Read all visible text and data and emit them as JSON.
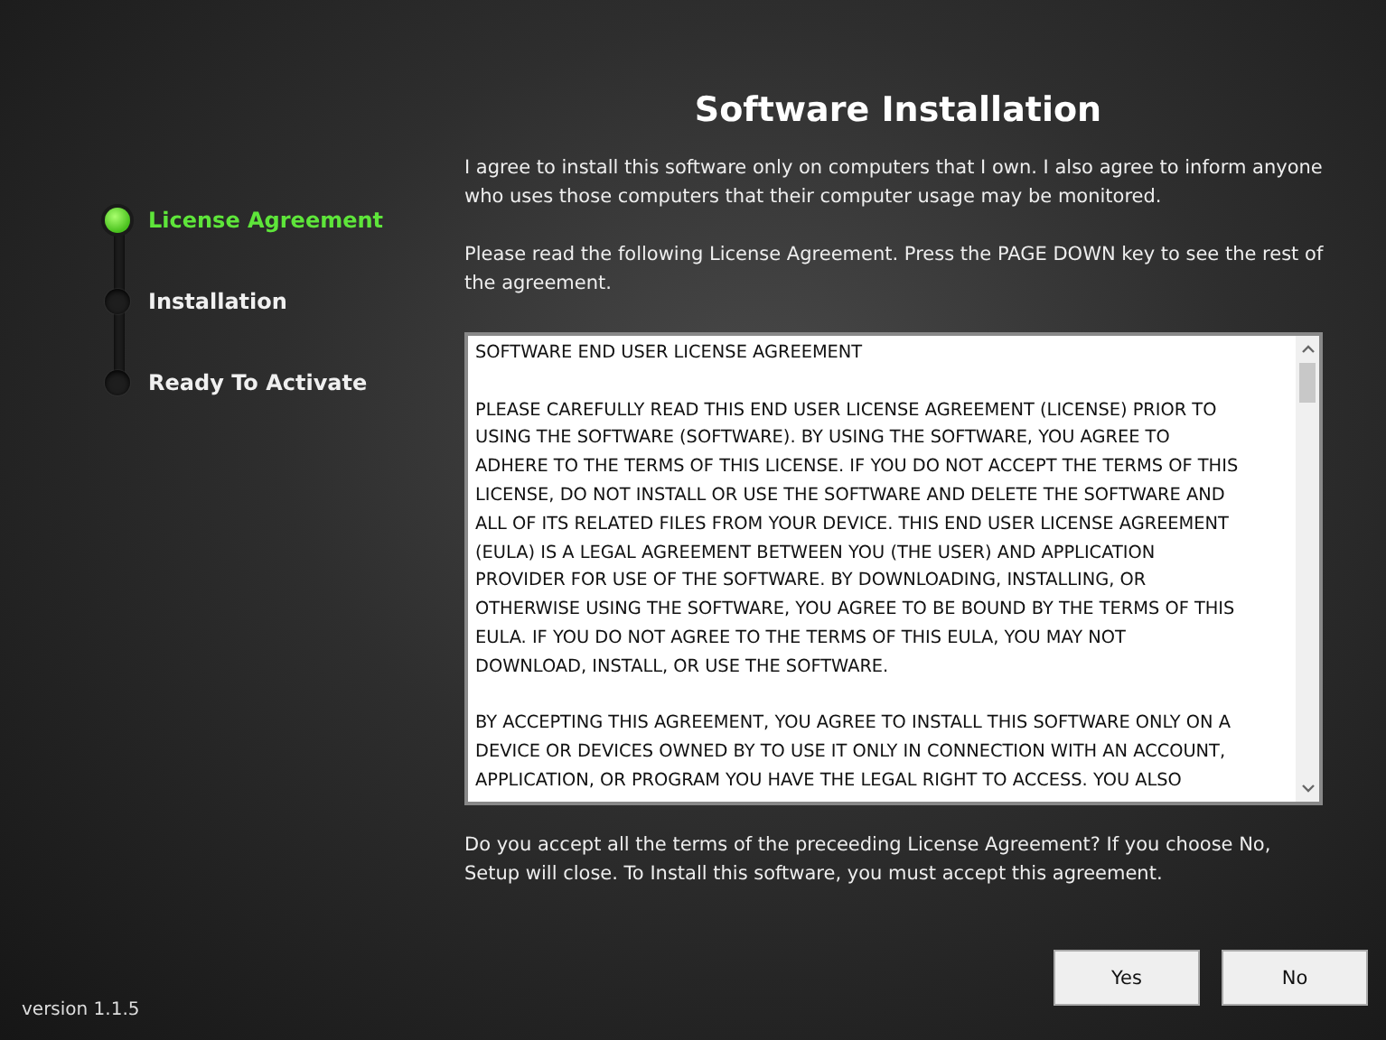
{
  "steps": [
    {
      "label": "License Agreement",
      "selected": true
    },
    {
      "label": "Installation",
      "selected": false
    },
    {
      "label": "Ready To Activate",
      "selected": false
    }
  ],
  "version": "version 1.1.5",
  "title": "Software Installation",
  "intro": "I agree to install this software only on computers that I own. I also agree to inform anyone who uses those computers that their computer usage may be monitored.",
  "instruction": "Please read the following License Agreement. Press the PAGE DOWN key to see the rest of the agreement.",
  "license_paragraphs": [
    [
      "SOFTWARE END USER LICENSE AGREEMENT"
    ],
    [
      "PLEASE CAREFULLY READ THIS END USER LICENSE AGREEMENT (LICENSE) PRIOR TO",
      "USING THE SOFTWARE (SOFTWARE). BY USING THE SOFTWARE, YOU AGREE TO",
      "ADHERE TO THE TERMS OF THIS LICENSE. IF YOU DO NOT ACCEPT THE TERMS OF THIS",
      "LICENSE, DO NOT INSTALL OR USE THE SOFTWARE AND DELETE THE SOFTWARE AND",
      "ALL OF ITS RELATED FILES FROM YOUR DEVICE. THIS END USER LICENSE AGREEMENT",
      "(EULA) IS A LEGAL AGREEMENT BETWEEN YOU (THE USER) AND APPLICATION",
      "PROVIDER FOR USE OF THE SOFTWARE. BY DOWNLOADING, INSTALLING, OR",
      "OTHERWISE USING THE SOFTWARE, YOU AGREE TO BE BOUND BY THE TERMS OF THIS",
      "EULA. IF YOU DO NOT AGREE TO THE TERMS OF THIS EULA, YOU MAY NOT",
      "DOWNLOAD, INSTALL, OR USE THE SOFTWARE."
    ],
    [
      "BY ACCEPTING THIS AGREEMENT, YOU AGREE TO INSTALL THIS SOFTWARE ONLY ON A",
      "DEVICE OR DEVICES OWNED BY TO USE IT ONLY IN CONNECTION WITH AN ACCOUNT,",
      "APPLICATION, OR PROGRAM YOU HAVE THE LEGAL RIGHT TO ACCESS. YOU ALSO"
    ]
  ],
  "question": "Do you accept all the terms of the preceeding License Agreement? If you choose No, Setup will close. To Install this software, you must accept this agreement.",
  "buttons": [
    "Yes",
    "No"
  ]
}
